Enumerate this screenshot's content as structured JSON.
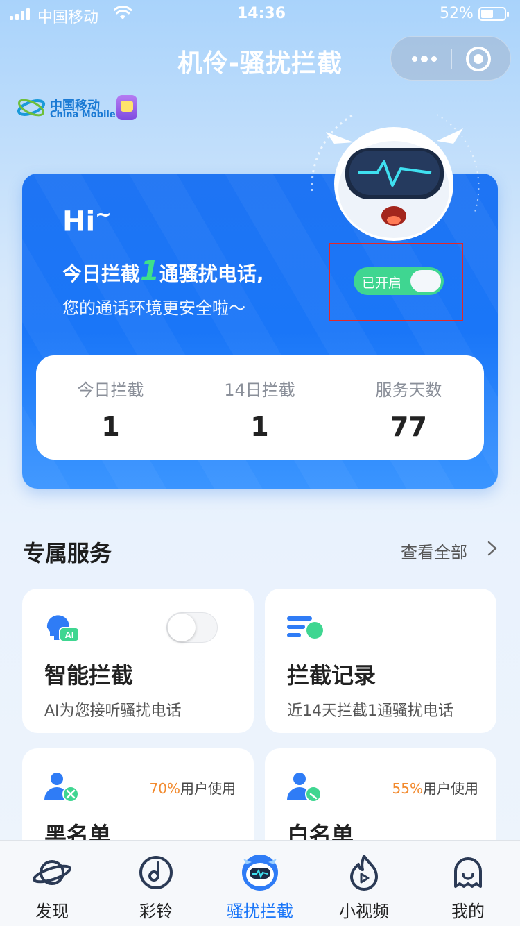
{
  "status_bar": {
    "carrier": "中国移动",
    "time": "14:36",
    "battery_percent": "52%",
    "battery_level": 0.52
  },
  "nav": {
    "title": "机伶-骚扰拦截",
    "more_icon": "more-dots-icon",
    "close_icon": "target-close-icon"
  },
  "brand": {
    "name_cn": "中国移动",
    "name_en": "China Mobile"
  },
  "hero": {
    "greeting": "Hi",
    "tilde": "~",
    "intercept_prefix": "今日拦截",
    "intercept_count": "1",
    "intercept_suffix": "通骚扰电话,",
    "subtitle": "您的通话环境更安全啦～",
    "toggle_label": "已开启",
    "toggle_on": true,
    "accent_color": "#1a76f8",
    "toggle_color": "#3fd691",
    "stats": [
      {
        "label": "今日拦截",
        "value": "1"
      },
      {
        "label": "14日拦截",
        "value": "1"
      },
      {
        "label": "服务天数",
        "value": "77"
      }
    ]
  },
  "services": {
    "title": "专属服务",
    "view_all": "查看全部",
    "cards": [
      {
        "title": "智能拦截",
        "desc": "AI为您接听骚扰电话",
        "icon": "ai-head-icon",
        "toggle_on": false
      },
      {
        "title": "拦截记录",
        "desc": "近14天拦截1通骚扰电话",
        "icon": "record-list-icon"
      },
      {
        "title": "黑名单",
        "usage_pct": "70%",
        "usage_text": "用户使用",
        "icon": "user-block-icon"
      },
      {
        "title": "白名单",
        "usage_pct": "55%",
        "usage_text": "用户使用",
        "icon": "user-allow-icon"
      }
    ]
  },
  "tabbar": {
    "items": [
      {
        "label": "发现",
        "icon": "planet-icon",
        "active": false
      },
      {
        "label": "彩铃",
        "icon": "music-note-icon",
        "active": false
      },
      {
        "label": "骚扰拦截",
        "icon": "robot-icon",
        "active": true
      },
      {
        "label": "小视频",
        "icon": "flame-play-icon",
        "active": false
      },
      {
        "label": "我的",
        "icon": "ghost-user-icon",
        "active": false
      }
    ]
  }
}
